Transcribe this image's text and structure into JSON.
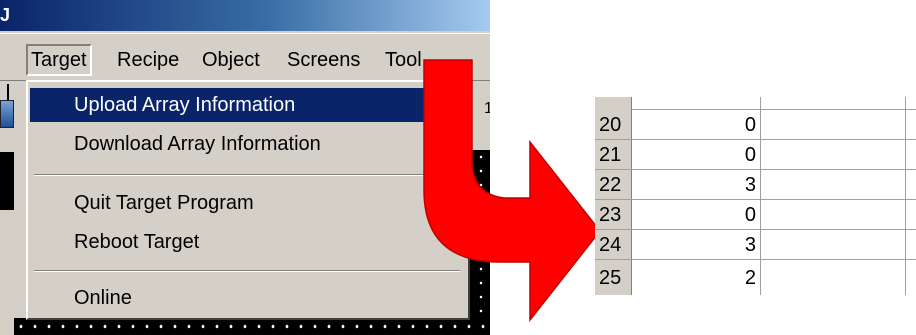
{
  "menubar": {
    "items": [
      {
        "label": "Target",
        "open": true
      },
      {
        "label": "Recipe"
      },
      {
        "label": "Object"
      },
      {
        "label": "Screens"
      },
      {
        "label": "Tool"
      }
    ]
  },
  "toolbar": {
    "partial_char": "1"
  },
  "target_menu": {
    "items": [
      {
        "label": "Upload Array Information",
        "highlighted": true
      },
      {
        "label": "Download Array Information"
      },
      {
        "label": "Quit Target Program"
      },
      {
        "label": "Reboot Target"
      },
      {
        "label": "Online"
      }
    ]
  },
  "spreadsheet": {
    "rows": [
      {
        "row": "20",
        "value": "0"
      },
      {
        "row": "21",
        "value": "0"
      },
      {
        "row": "22",
        "value": "3"
      },
      {
        "row": "23",
        "value": "0"
      },
      {
        "row": "24",
        "value": "3"
      },
      {
        "row": "25",
        "value": "2"
      }
    ]
  },
  "colors": {
    "menu_bg": "#d4d0c8",
    "highlight_bg": "#0a246a",
    "titlebar": "#0a246a",
    "arrow_red": "#ff0000"
  },
  "icons": {
    "arrow": "curved-arrow-right-icon",
    "toolbar": "toolbar-button-icon"
  }
}
